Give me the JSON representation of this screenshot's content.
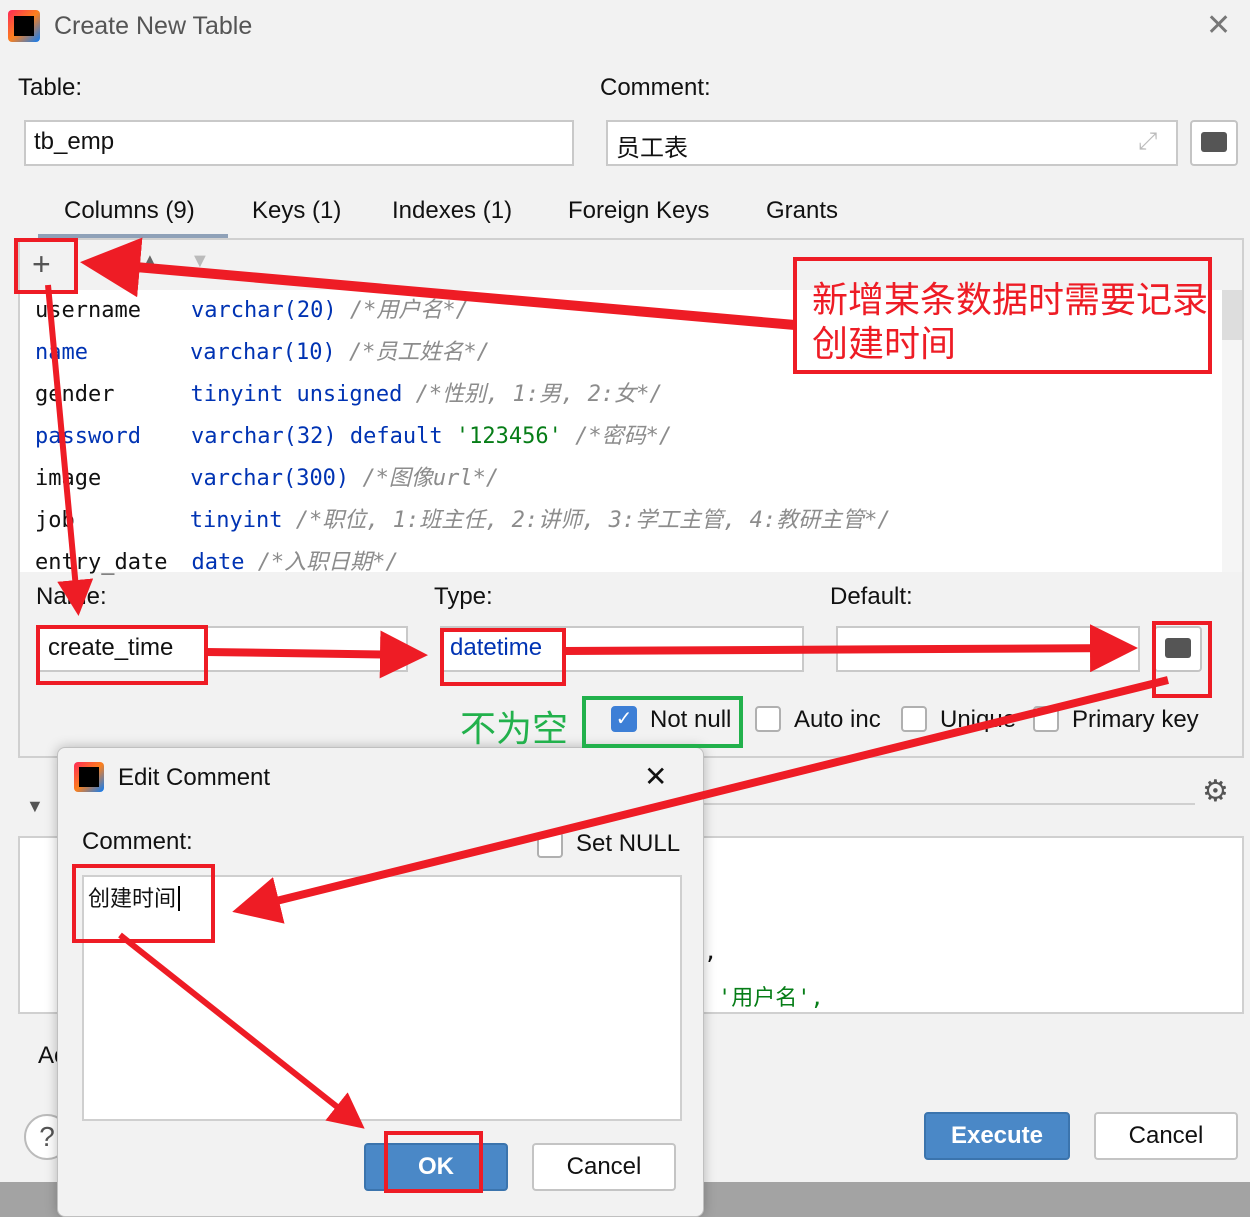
{
  "window": {
    "title": "Create New Table",
    "close_icon": "close-icon"
  },
  "table_label": "Table:",
  "table_value": "tb_emp",
  "comment_label": "Comment:",
  "comment_value": "员工表",
  "tabs": [
    "Columns (9)",
    "Keys (1)",
    "Indexes (1)",
    "Foreign Keys",
    "Grants"
  ],
  "columns": [
    {
      "name": "username",
      "type": "varchar(20)",
      "extra": "",
      "comment": "/*用户名*/"
    },
    {
      "name": "name",
      "type": "varchar(10)",
      "extra": "",
      "comment": "/*员工姓名*/"
    },
    {
      "name": "gender",
      "type": "tinyint unsigned",
      "extra": "",
      "comment": "/*性别, 1:男, 2:女*/"
    },
    {
      "name": "password",
      "type": "varchar(32) default",
      "extra": "'123456'",
      "comment": "/*密码*/"
    },
    {
      "name": "image",
      "type": "varchar(300)",
      "extra": "",
      "comment": "/*图像url*/"
    },
    {
      "name": "job",
      "type": "tinyint",
      "extra": "",
      "comment": "/*职位, 1:班主任, 2:讲师, 3:学工主管, 4:教研主管*/"
    },
    {
      "name": "entry_date",
      "type": "date",
      "extra": "",
      "comment": "/*入职日期*/"
    }
  ],
  "detail": {
    "name_label": "Name:",
    "name_value": "create_time",
    "type_label": "Type:",
    "type_value": "datetime",
    "default_label": "Default:",
    "default_value": "",
    "checkboxes": [
      {
        "label": "Not null",
        "checked": true
      },
      {
        "label": "Auto inc",
        "checked": false
      },
      {
        "label": "Unique",
        "checked": false
      },
      {
        "label": "Primary key",
        "checked": false
      }
    ]
  },
  "preview": {
    "line1": "'用户名',",
    "line2": ","
  },
  "footer": {
    "partial_label": "Ac",
    "execute": "Execute",
    "cancel": "Cancel",
    "help": "?"
  },
  "edit_comment": {
    "title": "Edit Comment",
    "comment_label": "Comment:",
    "set_null": "Set NULL",
    "value": "创建时间",
    "ok": "OK",
    "cancel": "Cancel"
  },
  "annotations": {
    "note": "新增某条数据时需要记录创建时间",
    "note_line1": "新增某条数据时需要记录",
    "note_line2": "创建时间",
    "not_null_note": "不为空",
    "color": "#ee1c25",
    "green": "#22b14c"
  }
}
